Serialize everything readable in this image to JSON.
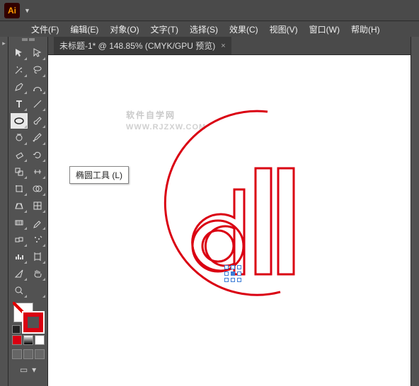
{
  "app": {
    "icon_text": "Ai"
  },
  "menu": [
    "文件(F)",
    "编辑(E)",
    "对象(O)",
    "文字(T)",
    "选择(S)",
    "效果(C)",
    "视图(V)",
    "窗口(W)",
    "帮助(H)"
  ],
  "document_tab": {
    "label": "未标题-1* @ 148.85% (CMYK/GPU 预览)",
    "close": "×"
  },
  "tooltip": "椭圆工具 (L)",
  "watermark": {
    "main": "软件自学网",
    "sub": "WWW.RJZXW.COM"
  },
  "tools": [
    {
      "name": "selection",
      "active": false
    },
    {
      "name": "direct-selection",
      "active": false
    },
    {
      "name": "magic-wand",
      "active": false
    },
    {
      "name": "lasso",
      "active": false
    },
    {
      "name": "pen",
      "active": false
    },
    {
      "name": "curvature",
      "active": false
    },
    {
      "name": "type",
      "active": false
    },
    {
      "name": "line",
      "active": false
    },
    {
      "name": "ellipse",
      "active": true
    },
    {
      "name": "brush",
      "active": false
    },
    {
      "name": "shaper",
      "active": false
    },
    {
      "name": "pencil",
      "active": false
    },
    {
      "name": "eraser",
      "active": false
    },
    {
      "name": "rotate",
      "active": false
    },
    {
      "name": "scale",
      "active": false
    },
    {
      "name": "width",
      "active": false
    },
    {
      "name": "free-transform",
      "active": false
    },
    {
      "name": "shape-builder",
      "active": false
    },
    {
      "name": "perspective",
      "active": false
    },
    {
      "name": "mesh",
      "active": false
    },
    {
      "name": "gradient",
      "active": false
    },
    {
      "name": "eyedropper",
      "active": false
    },
    {
      "name": "blend",
      "active": false
    },
    {
      "name": "symbol-sprayer",
      "active": false
    },
    {
      "name": "column-graph",
      "active": false
    },
    {
      "name": "artboard",
      "active": false
    },
    {
      "name": "slice",
      "active": false
    },
    {
      "name": "hand",
      "active": false
    },
    {
      "name": "zoom",
      "active": false
    },
    {
      "name": "blank",
      "active": false
    }
  ],
  "colors": {
    "stroke": "#da0012",
    "fill": "none"
  }
}
